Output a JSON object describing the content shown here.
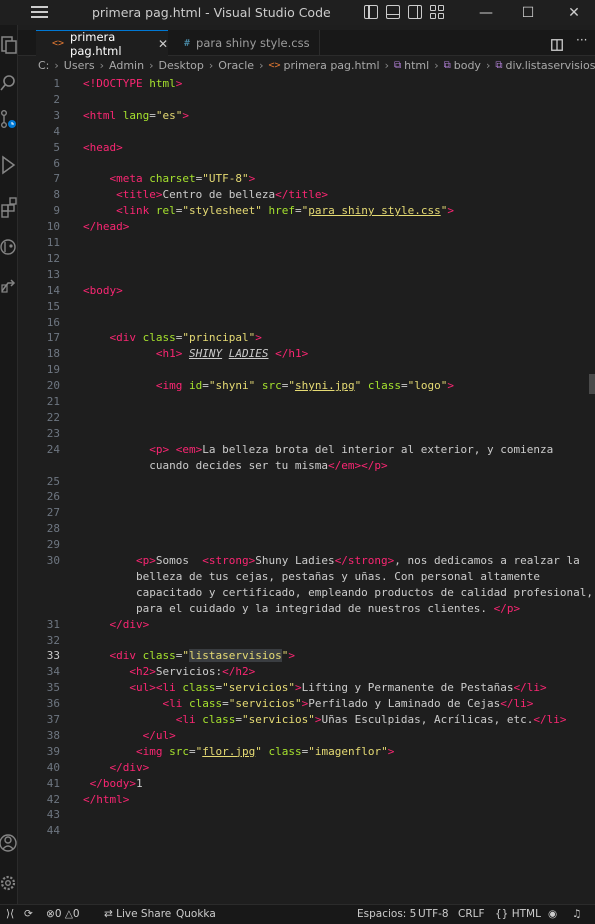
{
  "window": {
    "title": "primera pag.html - Visual Studio Code",
    "controls": {
      "minimize": "—",
      "maximize": "☐",
      "close": "✕"
    }
  },
  "activity_bar": [
    "explorer-icon",
    "search-icon",
    "source-control-icon",
    "run-debug-icon",
    "extensions-icon",
    "git-graph-icon",
    "remote-icon",
    "account-icon",
    "settings-gear-icon"
  ],
  "tabs": [
    {
      "label": "primera pag.html",
      "icon": "<>",
      "icon_color": "#e37933",
      "active": true,
      "close": "✕"
    },
    {
      "label": "para shiny style.css",
      "icon": "#",
      "icon_color": "#519aba",
      "active": false
    }
  ],
  "breadcrumb": [
    "C:",
    "Users",
    "Admin",
    "Desktop",
    "Oracle",
    "primera pag.html",
    "html",
    "body",
    "div.listaservisios"
  ],
  "editor": {
    "current_line": 33,
    "lines": [
      {
        "n": "1",
        "html": "<span class=\"t\">&lt;!DOCTYPE</span> <span class=\"a\">html</span><span class=\"t\">&gt;</span>"
      },
      {
        "n": "2",
        "html": ""
      },
      {
        "n": "3",
        "html": "<span class=\"t\">&lt;html</span> <span class=\"a\">lang</span>=<span class=\"s\">\"es\"</span><span class=\"t\">&gt;</span>"
      },
      {
        "n": "4",
        "html": ""
      },
      {
        "n": "5",
        "html": "<span class=\"t\">&lt;head&gt;</span>"
      },
      {
        "n": "6",
        "html": ""
      },
      {
        "n": "7",
        "html": "    <span class=\"t\">&lt;meta</span> <span class=\"a\">charset</span>=<span class=\"s\">\"UTF-8\"</span><span class=\"t\">&gt;</span>"
      },
      {
        "n": "8",
        "html": "     <span class=\"t\">&lt;title&gt;</span>Centro de belleza<span class=\"t\">&lt;/title&gt;</span>"
      },
      {
        "n": "9",
        "html": "     <span class=\"t\">&lt;link</span> <span class=\"a\">rel</span>=<span class=\"s\">\"stylesheet\"</span> <span class=\"a\">href</span>=<span class=\"s\">\"<span class=\"u\">para shiny style.css</span>\"</span><span class=\"t\">&gt;</span>"
      },
      {
        "n": "10",
        "html": "<span class=\"t\">&lt;/head&gt;</span>"
      },
      {
        "n": "11",
        "html": ""
      },
      {
        "n": "12",
        "html": ""
      },
      {
        "n": "13",
        "html": ""
      },
      {
        "n": "14",
        "html": "<span class=\"t\">&lt;body&gt;</span>"
      },
      {
        "n": "15",
        "html": ""
      },
      {
        "n": "16",
        "html": ""
      },
      {
        "n": "17",
        "html": "    <span class=\"t\">&lt;div</span> <span class=\"a\">class</span>=<span class=\"s\">\"principal\"</span><span class=\"t\">&gt;</span>"
      },
      {
        "n": "18",
        "html": "           <span class=\"t\">&lt;h1&gt;</span> <i class=\"u\">SHINY</i> <i class=\"u\">LADIES</i> <span class=\"t\">&lt;/h1&gt;</span>"
      },
      {
        "n": "19",
        "html": ""
      },
      {
        "n": "20",
        "html": "           <span class=\"t\">&lt;img</span> <span class=\"a\">id</span>=<span class=\"s\">\"shyni\"</span> <span class=\"a\">src</span>=<span class=\"s\">\"<span class=\"u\">shyni.jpg</span>\"</span> <span class=\"a\">class</span>=<span class=\"s\">\"logo\"</span><span class=\"t\">&gt;</span>"
      },
      {
        "n": "21",
        "html": ""
      },
      {
        "n": "22",
        "html": ""
      },
      {
        "n": "23",
        "html": ""
      },
      {
        "n": "24",
        "html": "          <span class=\"t\">&lt;p&gt;</span> <span class=\"t\">&lt;em&gt;</span>La belleza brota del interior al exterior, y comienza"
      },
      {
        "n": "",
        "html": "          cuando decides ser tu misma<span class=\"t\">&lt;/em&gt;&lt;/p&gt;</span>"
      },
      {
        "n": "25",
        "html": ""
      },
      {
        "n": "26",
        "html": ""
      },
      {
        "n": "27",
        "html": ""
      },
      {
        "n": "28",
        "html": ""
      },
      {
        "n": "29",
        "html": ""
      },
      {
        "n": "30",
        "html": "        <span class=\"t\">&lt;p&gt;</span>Somos  <span class=\"t\">&lt;strong&gt;</span>Shuny Ladies<span class=\"t\">&lt;/strong&gt;</span>, nos dedicamos a realzar la"
      },
      {
        "n": "",
        "html": "        belleza de tus cejas, pestañas y uñas. Con personal altamente"
      },
      {
        "n": "",
        "html": "        capacitado y certificado, empleando productos de calidad profesional,"
      },
      {
        "n": "",
        "html": "        para el cuidado y la integridad de nuestros clientes. <span class=\"t\">&lt;/p&gt;</span>"
      },
      {
        "n": "31",
        "html": "    <span class=\"t\">&lt;/div&gt;</span>"
      },
      {
        "n": "32",
        "html": ""
      },
      {
        "n": "33",
        "html": "    <span class=\"t\">&lt;div</span> <span class=\"a\">class</span>=<span class=\"s\">\"<span class=\"sel\">listaservisios</span>\"</span><span class=\"t\">&gt;</span>"
      },
      {
        "n": "34",
        "html": "       <span class=\"t\">&lt;h2&gt;</span>Servicios:<span class=\"t\">&lt;/h2&gt;</span>"
      },
      {
        "n": "35",
        "html": "       <span class=\"t\">&lt;ul&gt;&lt;li</span> <span class=\"a\">class</span>=<span class=\"s\">\"servicios\"</span><span class=\"t\">&gt;</span>Lifting y Permanente de Pestañas<span class=\"t\">&lt;/li&gt;</span>"
      },
      {
        "n": "36",
        "html": "            <span class=\"t\">&lt;li</span> <span class=\"a\">class</span>=<span class=\"s\">\"servicios\"</span><span class=\"t\">&gt;</span>Perfilado y Laminado de Cejas<span class=\"t\">&lt;/li&gt;</span>"
      },
      {
        "n": "37",
        "html": "              <span class=\"t\">&lt;li</span> <span class=\"a\">class</span>=<span class=\"s\">\"servicios\"</span><span class=\"t\">&gt;</span>Uñas Esculpidas, Acrílicas, etc.<span class=\"t\">&lt;/li&gt;</span>"
      },
      {
        "n": "38",
        "html": "         <span class=\"t\">&lt;/ul&gt;</span>"
      },
      {
        "n": "39",
        "html": "        <span class=\"t\">&lt;img</span> <span class=\"a\">src</span>=<span class=\"s\">\"<span class=\"u\">flor.jpg</span>\"</span> <span class=\"a\">class</span>=<span class=\"s\">\"imagenflor\"</span><span class=\"t\">&gt;</span>"
      },
      {
        "n": "40",
        "html": "    <span class=\"t\">&lt;/div&gt;</span>"
      },
      {
        "n": "41",
        "html": " <span class=\"t\">&lt;/body&gt;</span>1"
      },
      {
        "n": "42",
        "html": "<span class=\"t\">&lt;/html&gt;</span>"
      },
      {
        "n": "43",
        "html": ""
      },
      {
        "n": "44",
        "html": ""
      }
    ]
  },
  "status_bar": {
    "errors": "0",
    "warnings": "0",
    "live_share": "Live Share",
    "quokka": "Quokka",
    "indent": "Espacios: 5",
    "encoding": "UTF-8",
    "eol": "CRLF",
    "language": "HTML",
    "bell": "🔔"
  }
}
